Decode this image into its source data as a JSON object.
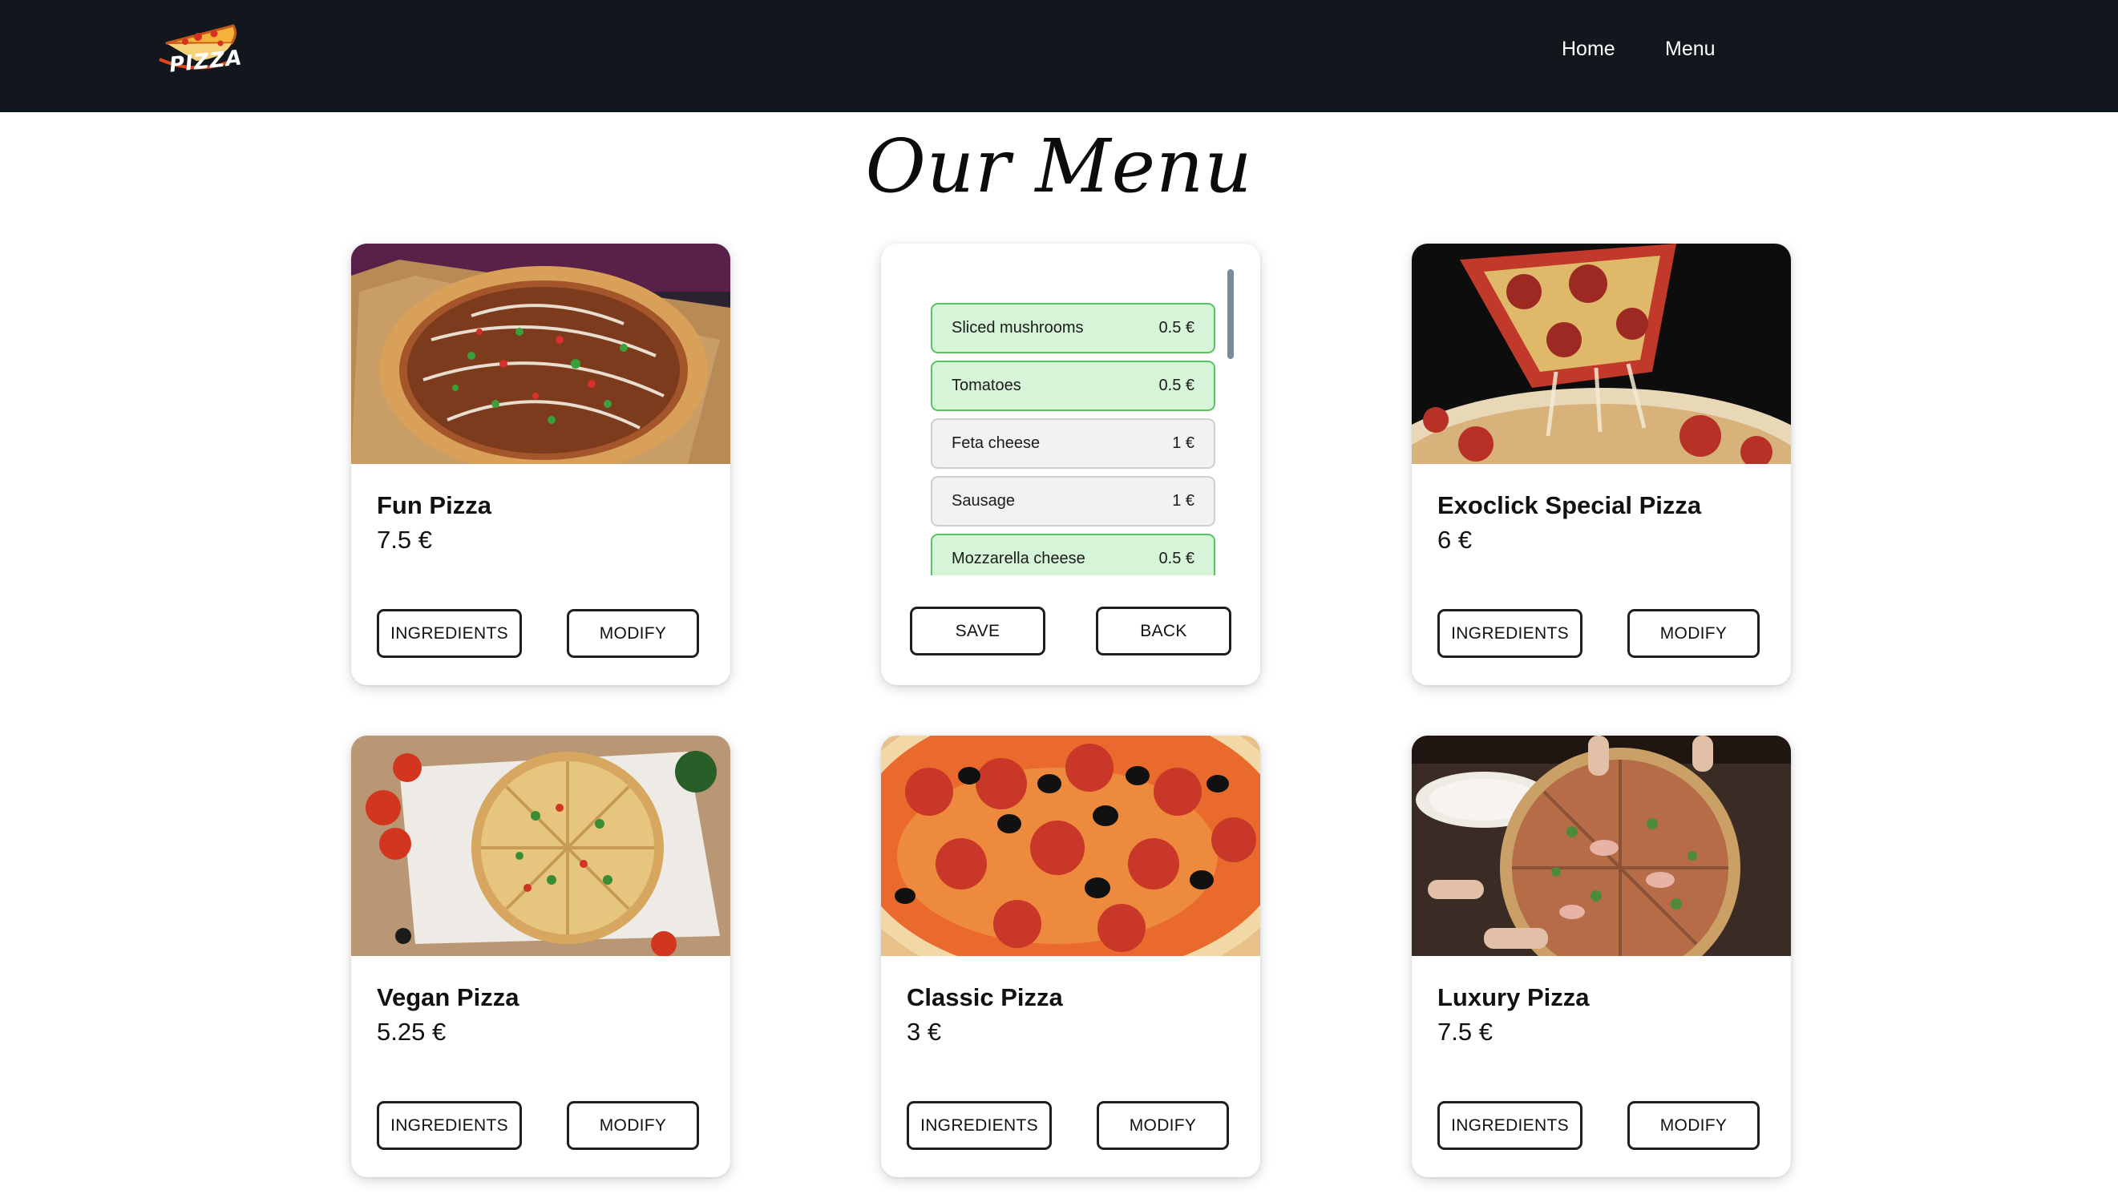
{
  "nav": {
    "logo_text": "PIZZA",
    "home_label": "Home",
    "menu_label": "Menu"
  },
  "page_title": "Our Menu",
  "colors": {
    "navbar_bg": "#12161d",
    "selected_ingredient_bg": "#d6f5d8",
    "selected_ingredient_border": "#58c461",
    "unselected_ingredient_bg": "#f2f2f2"
  },
  "cards": [
    {
      "name": "Fun Pizza",
      "price": "7.5 €",
      "ingredients_label": "INGREDIENTS",
      "modify_label": "MODIFY",
      "image_icon": "pizza-box-photo"
    },
    {
      "name": "Exoclick Special Pizza",
      "price": "6 €",
      "ingredients_label": "INGREDIENTS",
      "modify_label": "MODIFY",
      "image_icon": "pizza-slice-cheese-pull-photo"
    },
    {
      "name": "Vegan Pizza",
      "price": "5.25 €",
      "ingredients_label": "INGREDIENTS",
      "modify_label": "MODIFY",
      "image_icon": "vegan-pizza-photo"
    },
    {
      "name": "Classic Pizza",
      "price": "3 €",
      "ingredients_label": "INGREDIENTS",
      "modify_label": "MODIFY",
      "image_icon": "pepperoni-olive-pizza-photo"
    },
    {
      "name": "Luxury Pizza",
      "price": "7.5 €",
      "ingredients_label": "INGREDIENTS",
      "modify_label": "MODIFY",
      "image_icon": "luxury-pizza-table-photo"
    }
  ],
  "edit_card": {
    "save_label": "SAVE",
    "back_label": "BACK",
    "ingredients": [
      {
        "name": "Sliced mushrooms",
        "price": "0.5 €",
        "selected": true
      },
      {
        "name": "Tomatoes",
        "price": "0.5 €",
        "selected": true
      },
      {
        "name": "Feta cheese",
        "price": "1 €",
        "selected": false
      },
      {
        "name": "Sausage",
        "price": "1 €",
        "selected": false
      },
      {
        "name": "Mozzarella cheese",
        "price": "0.5 €",
        "selected": true
      }
    ]
  }
}
